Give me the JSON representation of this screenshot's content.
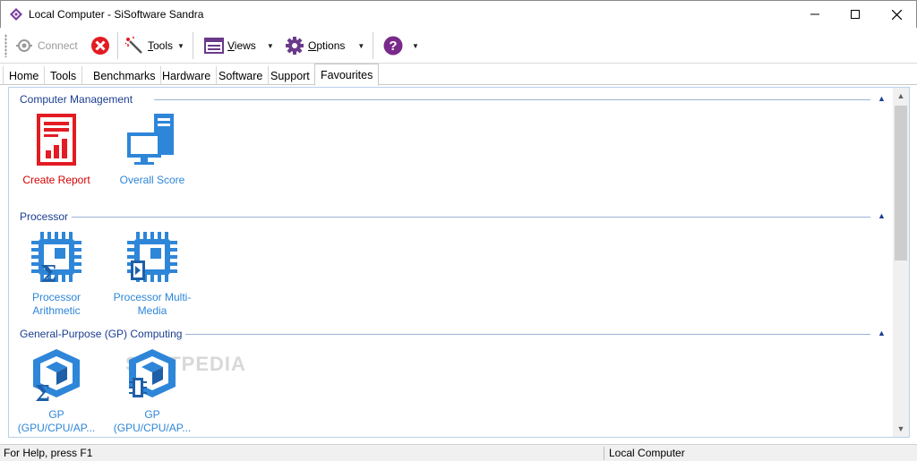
{
  "window": {
    "title": "Local Computer - SiSoftware Sandra"
  },
  "toolbar": {
    "connect_label": "Connect",
    "tools_label": "Tools",
    "views_label": "Views",
    "options_label": "Options"
  },
  "tabs": [
    {
      "label": "Home"
    },
    {
      "label": "Tools"
    },
    {
      "label": "Benchmarks"
    },
    {
      "label": "Hardware"
    },
    {
      "label": "Software"
    },
    {
      "label": "Support"
    },
    {
      "label": "Favourites",
      "active": true
    }
  ],
  "sections": [
    {
      "title": "Computer Management",
      "items": [
        {
          "label": "Create Report",
          "icon": "create-report-icon",
          "color": "#d40000"
        },
        {
          "label": "Overall Score",
          "icon": "overall-score-icon",
          "color": "#2e86d8"
        }
      ]
    },
    {
      "title": "Processor",
      "items": [
        {
          "label": "Processor Arithmetic",
          "icon": "processor-arithmetic-icon"
        },
        {
          "label": "Processor Multi-Media",
          "icon": "processor-multimedia-icon"
        }
      ]
    },
    {
      "title": "General-Purpose (GP) Computing",
      "items": [
        {
          "label": "GP (GPU/CPU/AP...",
          "icon": "gp-arithmetic-icon"
        },
        {
          "label": "GP (GPU/CPU/AP...",
          "icon": "gp-memory-icon"
        }
      ]
    }
  ],
  "watermark": "SOFTPEDIA",
  "statusbar": {
    "help_text": "For Help, press F1",
    "location": "Local Computer"
  },
  "colors": {
    "accent_blue": "#2e86d8",
    "section_blue": "#1b3d8f",
    "report_red": "#d40000",
    "help_purple": "#7a2a8a"
  }
}
